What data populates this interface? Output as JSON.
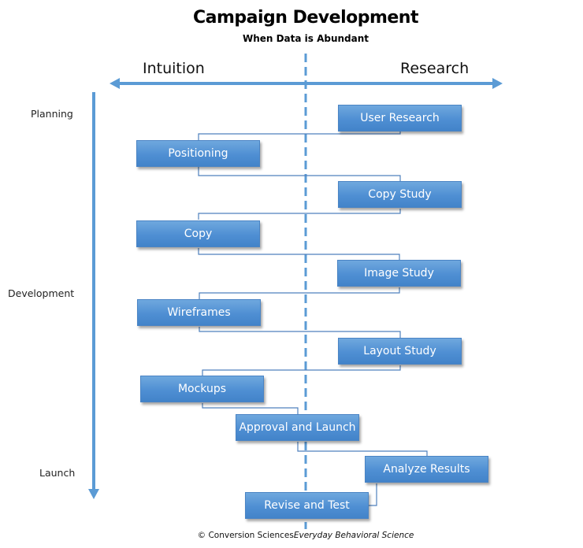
{
  "header": {
    "title": "Campaign Development",
    "subtitle": "When Data is Abundant"
  },
  "axis": {
    "left_label": "Intuition",
    "right_label": "Research"
  },
  "phases": [
    "Planning",
    "Development",
    "Launch"
  ],
  "steps": [
    {
      "label": "User Research",
      "side": "research"
    },
    {
      "label": "Positioning",
      "side": "intuition"
    },
    {
      "label": "Copy Study",
      "side": "research"
    },
    {
      "label": "Copy",
      "side": "intuition"
    },
    {
      "label": "Image Study",
      "side": "research"
    },
    {
      "label": "Wireframes",
      "side": "intuition"
    },
    {
      "label": "Layout Study",
      "side": "research"
    },
    {
      "label": "Mockups",
      "side": "intuition"
    },
    {
      "label": "Approval and Launch",
      "side": "center"
    },
    {
      "label": "Analyze Results",
      "side": "research"
    },
    {
      "label": "Revise and Test",
      "side": "center"
    }
  ],
  "footer": {
    "copyright": "© Conversion Sciences",
    "tagline": "Everyday Behavioral Science"
  },
  "colors": {
    "accent": "#5b9bd5",
    "box_fill": "#5592d5",
    "connector": "#4f81bd"
  }
}
